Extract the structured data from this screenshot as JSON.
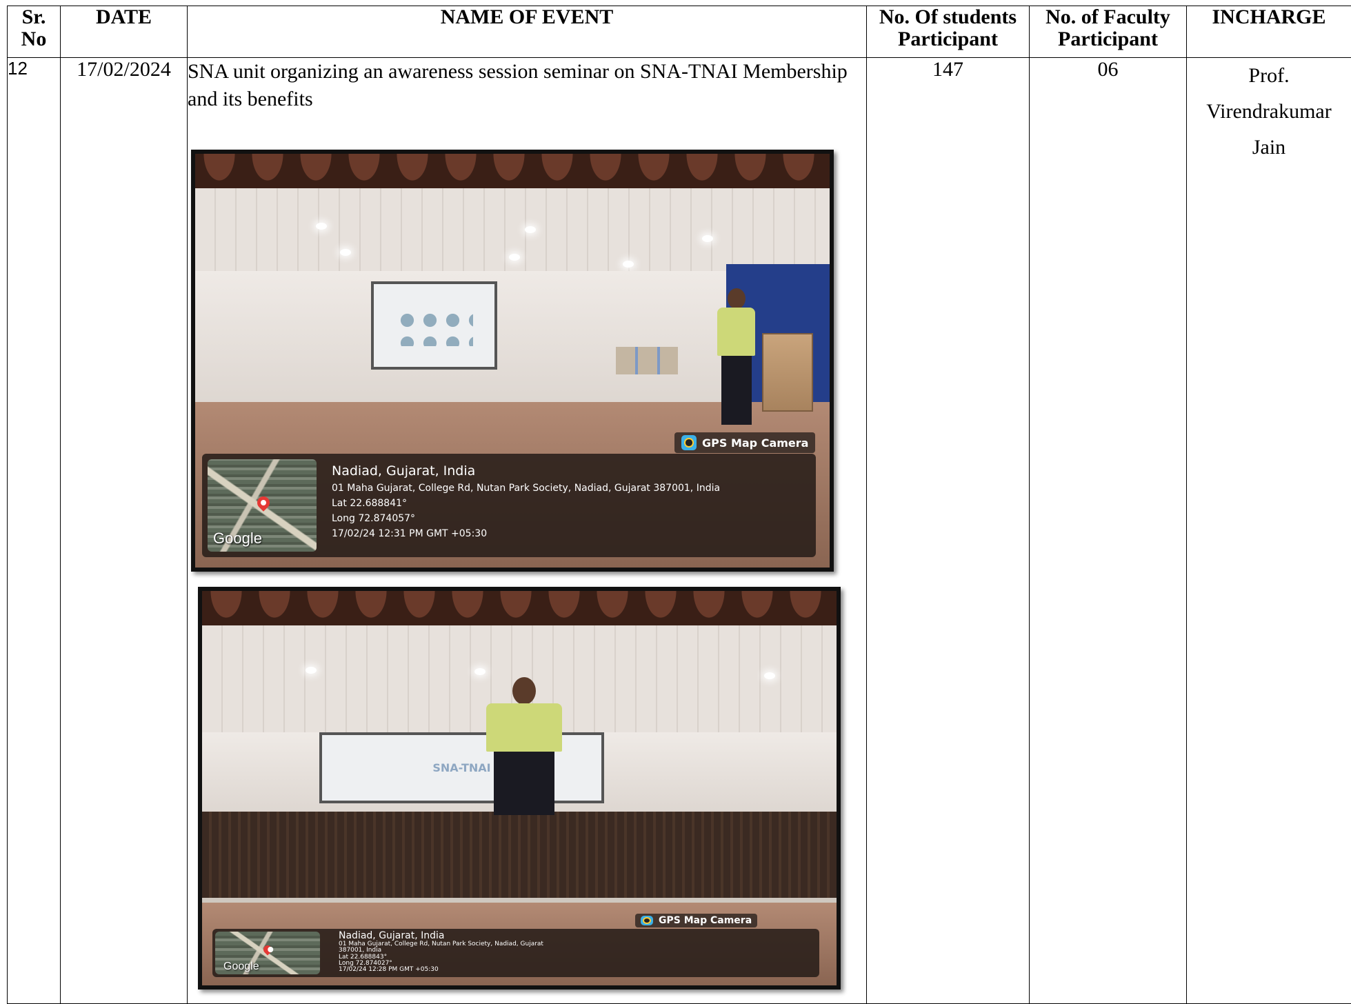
{
  "table": {
    "headers": {
      "sr": "Sr.\nNo",
      "date": "DATE",
      "name": "NAME OF EVENT",
      "students": "No. Of students Participant",
      "faculty": "No. of Faculty Participant",
      "incharge": "INCHARGE"
    },
    "row": {
      "sr": "12",
      "date": "17/02/2024",
      "event_name": "SNA unit organizing an awareness session seminar on SNA-TNAI Membership and its benefits",
      "students": "147",
      "faculty": "06",
      "incharge_line1": "Prof.",
      "incharge_line2": "Virendrakumar",
      "incharge_line3": "Jain"
    }
  },
  "photos": [
    {
      "badge": "GPS Map Camera",
      "map_logo": "Google",
      "place": "Nadiad, Gujarat, India",
      "address": "01 Maha Gujarat, College Rd, Nutan Park Society, Nadiad, Gujarat 387001, India",
      "lat": "Lat 22.688841°",
      "long": "Long 72.874057°",
      "timestamp": "17/02/24 12:31 PM GMT +05:30",
      "icons": [
        "camera-icon",
        "map-pin-icon"
      ]
    },
    {
      "badge": "GPS Map Camera",
      "map_logo": "Google",
      "place": "Nadiad, Gujarat, India",
      "address_line1": "01 Maha Gujarat, College Rd, Nutan Park Society, Nadiad, Gujarat",
      "address_line2": "387001, India",
      "lat": "Lat 22.688843°",
      "long": "Long 72.874027°",
      "timestamp": "17/02/24 12:28 PM GMT +05:30",
      "screen_text": "SNA-TNAI",
      "icons": [
        "camera-icon",
        "map-pin-icon"
      ]
    }
  ]
}
